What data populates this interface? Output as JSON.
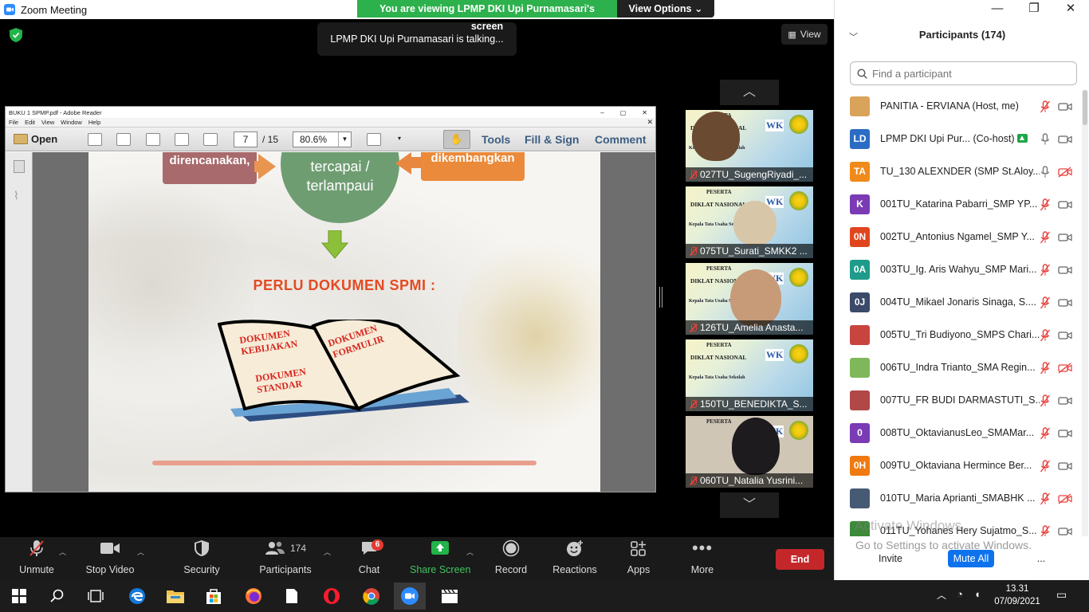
{
  "window": {
    "title": "Zoom Meeting"
  },
  "banner": {
    "viewing_text": "You are viewing LPMP DKI Upi Purnamasari's screen",
    "view_options": "View Options"
  },
  "stage": {
    "talking": "LPMP DKI Upi Purnamasari is talking...",
    "view_label": "View"
  },
  "reader": {
    "title": "BUKU 1 SPMP.pdf - Adobe Reader",
    "menu": [
      "File",
      "Edit",
      "View",
      "Window",
      "Help"
    ],
    "open_label": "Open",
    "page_current": "7",
    "page_total": "15",
    "zoom": "80.6%",
    "links": [
      "Tools",
      "Fill & Sign",
      "Comment"
    ]
  },
  "slide": {
    "box_left": "direncanakan,",
    "circle_line1": "tercapai /",
    "circle_line2": "terlampaui",
    "box_right": "dikembangkan",
    "heading": "PERLU DOKUMEN SPMI :",
    "book_left_1a": "DOKUMEN",
    "book_left_1b": "KEBIJAKAN",
    "book_left_2a": "DOKUMEN",
    "book_left_2b": "STANDAR",
    "book_right_1a": "DOKUMEN",
    "book_right_1b": "FORMULIR"
  },
  "thumbnails": [
    {
      "name": "027TU_SugengRiyadi_..."
    },
    {
      "name": "075TU_Surati_SMKK2 ..."
    },
    {
      "name": "126TU_Amelia Anasta..."
    },
    {
      "name": "150TU_BENEDIKTA_S..."
    },
    {
      "name": "060TU_Natalia Yusrini..."
    }
  ],
  "thumb_banner": {
    "peserta": "PESERTA",
    "diklat": "DIKLAT NASIONAL",
    "kepala": "Kepala Tata Usaha Sekolah",
    "logo": "WK"
  },
  "controls": {
    "unmute": "Unmute",
    "stop_video": "Stop Video",
    "security": "Security",
    "participants": "Participants",
    "participants_count": "174",
    "chat": "Chat",
    "chat_badge": "6",
    "share_screen": "Share Screen",
    "record": "Record",
    "reactions": "Reactions",
    "apps": "Apps",
    "more": "More",
    "end": "End"
  },
  "panel": {
    "title": "Participants (174)",
    "search_placeholder": "Find a participant",
    "participants": [
      {
        "name": "PANITIA - ERVIANA (Host, me)",
        "initials": "",
        "color": "#d9a35a",
        "mic": "muted",
        "cam": "on"
      },
      {
        "name": "LPMP DKI Upi Pur... (Co-host)",
        "initials": "LD",
        "color": "#2b6cc4",
        "mic": "on",
        "cam": "on",
        "sharing": true
      },
      {
        "name": "TU_130 ALEXNDER (SMP St.Aloy...",
        "initials": "TA",
        "color": "#f08a1a",
        "mic": "on",
        "cam": "off"
      },
      {
        "name": "001TU_Katarina Pabarri_SMP YP...",
        "initials": "K",
        "color": "#7a3bb4",
        "mic": "muted",
        "cam": "on"
      },
      {
        "name": "002TU_Antonius Ngamel_SMP Y...",
        "initials": "0N",
        "color": "#e0461e",
        "mic": "muted",
        "cam": "on"
      },
      {
        "name": "003TU_Ig. Aris Wahyu_SMP Mari...",
        "initials": "0A",
        "color": "#1e9b8a",
        "mic": "muted",
        "cam": "on"
      },
      {
        "name": "004TU_Mikael Jonaris Sinaga, S....",
        "initials": "0J",
        "color": "#3a4a68",
        "mic": "muted",
        "cam": "on"
      },
      {
        "name": "005TU_Tri Budiyono_SMPS Chari...",
        "initials": "",
        "color": "#c8453f",
        "mic": "muted",
        "cam": "on"
      },
      {
        "name": "006TU_Indra Trianto_SMA Regin...",
        "initials": "",
        "color": "#7fb85a",
        "mic": "muted",
        "cam": "off"
      },
      {
        "name": "007TU_FR BUDI DARMASTUTI_S...",
        "initials": "",
        "color": "#b04848",
        "mic": "muted",
        "cam": "on"
      },
      {
        "name": "008TU_OktavianusLeo_SMAMar...",
        "initials": "0",
        "color": "#7a3bb4",
        "mic": "muted",
        "cam": "on"
      },
      {
        "name": "009TU_Oktaviana Hermince Ber...",
        "initials": "0H",
        "color": "#f07a12",
        "mic": "muted",
        "cam": "on"
      },
      {
        "name": "010TU_Maria Aprianti_SMABHK ...",
        "initials": "",
        "color": "#475a74",
        "mic": "muted",
        "cam": "off"
      },
      {
        "name": "011TU_Yohanes Hery Sujatmo_S...",
        "initials": "",
        "color": "#3d8a3a",
        "mic": "muted",
        "cam": "on"
      }
    ],
    "invite": "Invite",
    "mute_all": "Mute All",
    "more": "..."
  },
  "watermark": {
    "line1": "Activate Windows",
    "line2": "Go to Settings to activate Windows."
  },
  "clock": {
    "time": "13.31",
    "date": "07/09/2021"
  }
}
